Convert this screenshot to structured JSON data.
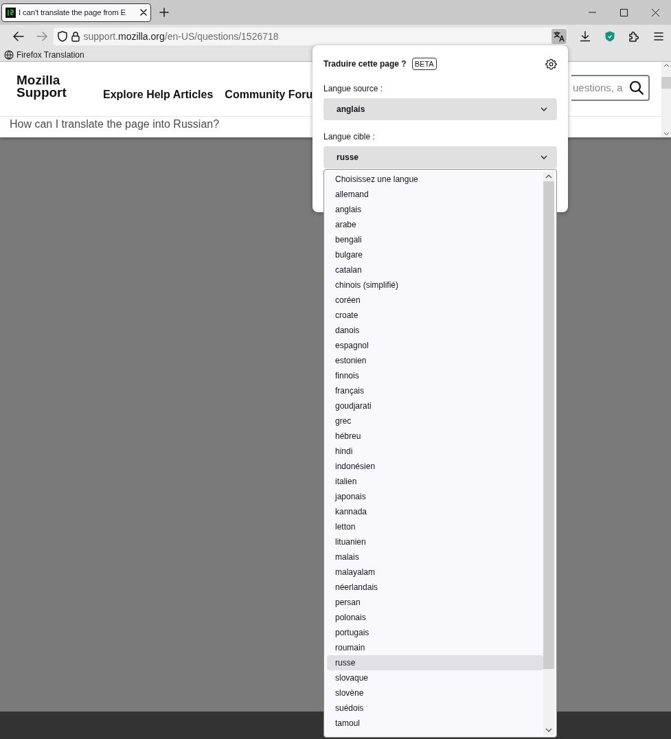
{
  "tab": {
    "title": "I can't translate the page from E",
    "selected": true
  },
  "address": {
    "prefix": "support.",
    "domain": "mozilla.org",
    "path": "/en-US/questions/1526718"
  },
  "translate_button": {
    "active": true
  },
  "bookmarks": [
    {
      "label": "Firefox Translation"
    }
  ],
  "site": {
    "logo": [
      "Mozilla",
      "Support"
    ],
    "nav": [
      "Explore Help Articles",
      "Community Foru"
    ],
    "search_placeholder": "uestions, a",
    "question": "How can I translate the page into Russian?"
  },
  "popup": {
    "title": "Traduire cette page ?",
    "badge": "BETA",
    "source_label": "Langue source :",
    "source_value": "anglais",
    "target_label": "Langue cible :",
    "target_value": "russe",
    "options": [
      {
        "label": "Choisissez une langue",
        "selected": false
      },
      {
        "label": "allemand",
        "selected": false
      },
      {
        "label": "anglais",
        "selected": false
      },
      {
        "label": "arabe",
        "selected": false
      },
      {
        "label": "bengali",
        "selected": false
      },
      {
        "label": "bulgare",
        "selected": false
      },
      {
        "label": "catalan",
        "selected": false
      },
      {
        "label": "chinois (simplifié)",
        "selected": false
      },
      {
        "label": "coréen",
        "selected": false
      },
      {
        "label": "croate",
        "selected": false
      },
      {
        "label": "danois",
        "selected": false
      },
      {
        "label": "espagnol",
        "selected": false
      },
      {
        "label": "estonien",
        "selected": false
      },
      {
        "label": "finnois",
        "selected": false
      },
      {
        "label": "français",
        "selected": false
      },
      {
        "label": "goudjarati",
        "selected": false
      },
      {
        "label": "grec",
        "selected": false
      },
      {
        "label": "hébreu",
        "selected": false
      },
      {
        "label": "hindi",
        "selected": false
      },
      {
        "label": "indonésien",
        "selected": false
      },
      {
        "label": "italien",
        "selected": false
      },
      {
        "label": "japonais",
        "selected": false
      },
      {
        "label": "kannada",
        "selected": false
      },
      {
        "label": "letton",
        "selected": false
      },
      {
        "label": "lituanien",
        "selected": false
      },
      {
        "label": "malais",
        "selected": false
      },
      {
        "label": "malayalam",
        "selected": false
      },
      {
        "label": "néerlandais",
        "selected": false
      },
      {
        "label": "persan",
        "selected": false
      },
      {
        "label": "polonais",
        "selected": false
      },
      {
        "label": "portugais",
        "selected": false
      },
      {
        "label": "roumain",
        "selected": false
      },
      {
        "label": "russe",
        "selected": true
      },
      {
        "label": "slovaque",
        "selected": false
      },
      {
        "label": "slovène",
        "selected": false
      },
      {
        "label": "suédois",
        "selected": false
      },
      {
        "label": "tamoul",
        "selected": false
      }
    ]
  }
}
